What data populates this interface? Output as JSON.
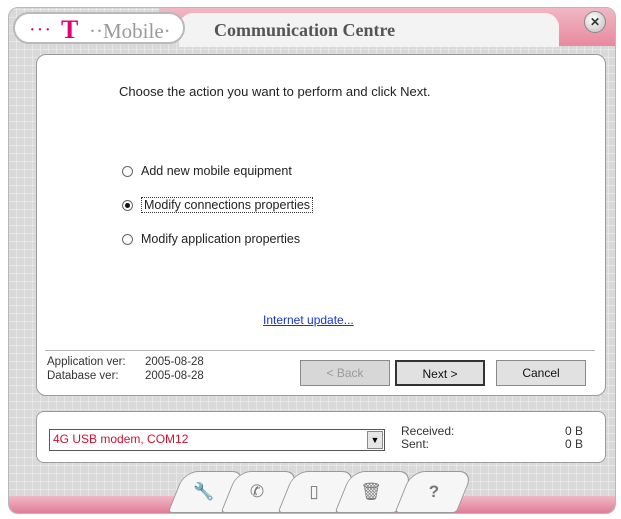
{
  "brand": {
    "dots": "···",
    "t": "T",
    "word": "··Mobile·"
  },
  "app": {
    "title": "Communication Centre"
  },
  "window": {
    "close_glyph": "✕"
  },
  "wizard": {
    "prompt": "Choose the action you want to perform and click Next.",
    "options": [
      {
        "label": "Add new mobile equipment",
        "selected": false
      },
      {
        "label": "Modify connections properties",
        "selected": true
      },
      {
        "label": "Modify application properties",
        "selected": false
      }
    ],
    "internet_update": "Internet update...",
    "application_ver_label": "Application ver:",
    "application_ver": "2005-08-28",
    "database_ver_label": "Database ver:",
    "database_ver": "2005-08-28",
    "back_label": "< Back",
    "next_label": "Next >",
    "cancel_label": "Cancel"
  },
  "status": {
    "device": "4G USB modem, COM12",
    "received_label": "Received:",
    "received_value": "0 B",
    "sent_label": "Sent:",
    "sent_value": "0 B"
  },
  "toolbar": {
    "tabs": [
      "wrench-icon",
      "phone-icon",
      "mobile-icon",
      "trash-icon",
      "help-icon"
    ],
    "help_glyph": "?"
  },
  "colors": {
    "brand_magenta": "#e20074",
    "accent_pink": "#e8899f",
    "device_text": "#d01030"
  }
}
